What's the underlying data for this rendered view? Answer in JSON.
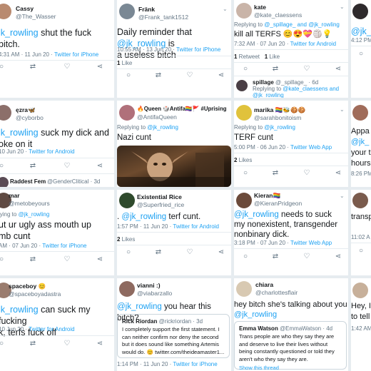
{
  "colors": {
    "link": "#1da1f2",
    "text": "#14171a",
    "muted": "#657786",
    "divider": "#e6ecf0"
  },
  "icons": [
    "reply-icon",
    "retweet-icon",
    "like-icon",
    "share-icon",
    "chevron-down-icon"
  ],
  "tweets": [
    {
      "name": "Cassy",
      "handle": "@The_Wasser",
      "mention": "@jk_rowling",
      "body_visible": "jk_rowling",
      "text": " shut the fuck",
      "text2": "bitch.",
      "time": "4:31 AM · 11 Jun 20 · ",
      "source": "Twitter for iPhone"
    },
    {
      "name": "Fränk",
      "handle": "@Frank_tank1512",
      "text_a": "Daily reminder that ",
      "mention": "@jk_rowling",
      "text_b": " is",
      "text2": "a useless bitch",
      "time": "10:55 AM · 13 Jun 20 · ",
      "source": "Twitter for iPhone",
      "likes_count": "1",
      "likes_label": " Like"
    },
    {
      "name": "kate",
      "handle": "@kate_claessens",
      "reply_prefix": "Replying to ",
      "reply_to": "@_spillage_ and @jk_rowling",
      "text": "kill all TERFS 😊😍💝🏐💡",
      "time": "7:32 AM · 07 Jun 20 · ",
      "source": "Twitter for Android",
      "retweets_count": "1",
      "retweets_label": " Retweet",
      "likes_count": "1",
      "likes_label": " Like",
      "reply": {
        "name": "spillage",
        "handle": "@_spillage_ · 6d",
        "reply_prefix": "Replying to ",
        "reply_to": "@kate_claessens and",
        "reply_to2": "@jk_rowling"
      }
    },
    {
      "mention": "@jk_",
      "time": "4:12 PM"
    },
    {
      "name": "ęzra🦋",
      "handle": "@cyborbo",
      "mention": "@jk_rowling",
      "body_visible": "jk_rowling",
      "text": " suck my dick and",
      "text2": "oke on it",
      "time": "10 Jun 20 · ",
      "source": "Twitter for Android",
      "next": {
        "name": "Raddest Fem",
        "handle": "@GenderClitical · 3d"
      }
    },
    {
      "name": "🔥Queen 🎲Antifa🏳️‍🌈🚩 #Uprising",
      "handle": "@AntifaQueen",
      "reply_prefix": "Replying to ",
      "reply_to": "@jk_rowling",
      "text": "Nazi cunt"
    },
    {
      "name": "marika 🏳️‍🌈🐝🍪🍪",
      "handle": "@sarahbonitoism",
      "reply_prefix": "Replying to ",
      "reply_to": "@jk_rowling",
      "text": "TERF cunt",
      "time": "5:00 PM · 06 Jun 20 · ",
      "source": "Twitter Web App",
      "likes_count": "2",
      "likes_label": " Likes"
    },
    {
      "l1": "Appa",
      "mention": "@jk_",
      "l3": "your t",
      "l4": "hours",
      "time": "8:26 PM"
    },
    {
      "name": "mar",
      "handle": "@metobeyours",
      "reply_prefix": "lying to ",
      "reply_to": "@jk_rowling",
      "text": "ut ur ugly ass mouth up",
      "text2": "mb cunt",
      "time": "AM · 07 Jun 20 · ",
      "source": "Twitter for iPhone"
    },
    {
      "name": "Existential Rice",
      "handle": "@Superfried_rice",
      "dot": ". ",
      "mention": "@jk_rowling",
      "text": " terf cunt.",
      "time": "1:57 PM · 11 Jun 20 · ",
      "source": "Twitter for Android",
      "likes_count": "2",
      "likes_label": " Likes"
    },
    {
      "name": "Kieran🏳️‍🌈",
      "handle": "@KieranPridgeon",
      "mention": "@jk_rowling",
      "text": " needs to suck",
      "text2": "my nonexistent, transgender",
      "text3": "nonbinary dick.",
      "time": "3:18 PM · 07 Jun 20 · ",
      "source": "Twitter Web App"
    },
    {
      "l1": "transp",
      "time": "11:02 A"
    },
    {
      "name": "spaceboy 😊",
      "handle": "@spaceboyadastra",
      "mention": "@jk_rowling",
      "body_visible": "jk_rowling",
      "text": " can suck my fucking",
      "text2": "k, terfs fuck off",
      "time": "10 Jun 20 · ",
      "source": "Twitter for Android"
    },
    {
      "name": "vianni :)",
      "handle": "@viabarzallo",
      "mention": "@jk_rowling",
      "text": " you hear this bitch?",
      "time": "1:14 PM · 11 Jun 20 · ",
      "source": "Twitter for iPhone",
      "quote": {
        "name": "Rick Riordan",
        "handle": "@rickriordan · 3d",
        "body": "I completely support the first statement. I can neither confirm nor deny the second but it does sound like something Artemis would do. 😊 twitter.com/theideamaster1..."
      }
    },
    {
      "name": "chiara",
      "handle": "@charlottesflair",
      "text": "hey bitch she's talking about you",
      "mention": "@jk_rowling",
      "quote": {
        "name": "Emma Watson",
        "handle": "@EmmaWatson · 4d",
        "body": "Trans people are who they say they are and deserve to live their lives without being constantly questioned or told they aren't who they say they are.",
        "link": "Show this thread"
      }
    },
    {
      "l1": "Hey, I",
      "l2": "to tell",
      "time": "1:42 AM"
    }
  ]
}
